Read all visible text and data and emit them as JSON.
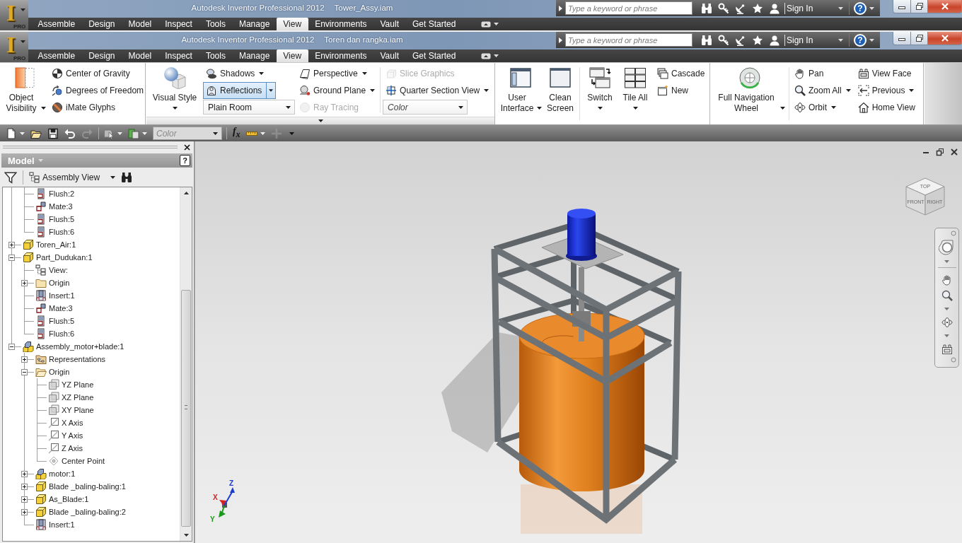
{
  "windows": [
    {
      "logo": "I",
      "edition": "PRO",
      "title": "Autodesk Inventor Professional 2012",
      "document": "Tower_Assy.iam",
      "search": {
        "placeholder": "Type a keyword or phrase"
      },
      "sign_in": "Sign In",
      "help": "?",
      "tabs": [
        {
          "label": "Assemble",
          "selected": false
        },
        {
          "label": "Design",
          "selected": false
        },
        {
          "label": "Model",
          "selected": false
        },
        {
          "label": "Inspect",
          "selected": false
        },
        {
          "label": "Tools",
          "selected": false
        },
        {
          "label": "Manage",
          "selected": false
        },
        {
          "label": "View",
          "selected": true
        },
        {
          "label": "Environments",
          "selected": false
        },
        {
          "label": "Vault",
          "selected": false
        },
        {
          "label": "Get Started",
          "selected": false
        }
      ]
    },
    {
      "logo": "I",
      "edition": "PRO",
      "title": "Autodesk Inventor Professional 2012",
      "document": "Toren dan rangka.iam",
      "search": {
        "placeholder": "Type a keyword or phrase"
      },
      "sign_in": "Sign In",
      "help": "?",
      "tabs": [
        {
          "label": "Assemble",
          "selected": false
        },
        {
          "label": "Design",
          "selected": false
        },
        {
          "label": "Model",
          "selected": false
        },
        {
          "label": "Inspect",
          "selected": false
        },
        {
          "label": "Tools",
          "selected": false
        },
        {
          "label": "Manage",
          "selected": false
        },
        {
          "label": "View",
          "selected": true
        },
        {
          "label": "Environments",
          "selected": false
        },
        {
          "label": "Vault",
          "selected": false
        },
        {
          "label": "Get Started",
          "selected": false
        }
      ]
    }
  ],
  "ribbon": {
    "panels": [
      {
        "slideout": false,
        "groups": [
          {
            "columns": [
              {
                "kind": "large",
                "items": [
                  {
                    "label": "Object Visibility",
                    "dropdown": true
                  }
                ]
              },
              {
                "kind": "small",
                "items": [
                  {
                    "kind": "button",
                    "label": "Center of Gravity",
                    "dropdown": false,
                    "on": false,
                    "disabled": false
                  },
                  {
                    "kind": "button",
                    "label": "Degrees of Freedom",
                    "dropdown": false,
                    "on": false,
                    "disabled": false
                  },
                  {
                    "kind": "button",
                    "label": "iMate Glyphs",
                    "dropdown": false,
                    "on": false,
                    "disabled": false
                  }
                ]
              }
            ]
          }
        ]
      },
      {
        "slideout": true,
        "groups": [
          {
            "columns": [
              {
                "kind": "large",
                "items": [
                  {
                    "label": "Visual Style",
                    "dropdown": true
                  }
                ]
              },
              {
                "kind": "small",
                "items": [
                  {
                    "kind": "button",
                    "label": "Shadows",
                    "dropdown": true,
                    "on": false,
                    "disabled": false
                  },
                  {
                    "kind": "button",
                    "label": "Reflections",
                    "dropdown": true,
                    "on": true,
                    "disabled": false
                  },
                  {
                    "kind": "select",
                    "value": "Plain Room"
                  }
                ]
              },
              {
                "kind": "small",
                "items": [
                  {
                    "kind": "button",
                    "label": "Perspective",
                    "dropdown": true,
                    "on": false,
                    "disabled": false
                  },
                  {
                    "kind": "button",
                    "label": "Ground Plane",
                    "dropdown": true,
                    "on": false,
                    "disabled": false
                  },
                  {
                    "kind": "button",
                    "label": "Ray Tracing",
                    "dropdown": false,
                    "on": false,
                    "disabled": true
                  }
                ]
              }
            ]
          },
          {
            "columns": [
              {
                "kind": "small",
                "items": [
                  {
                    "kind": "button",
                    "label": "Slice Graphics",
                    "dropdown": false,
                    "on": false,
                    "disabled": true
                  },
                  {
                    "kind": "button",
                    "label": "Quarter Section View",
                    "dropdown": true,
                    "on": false,
                    "disabled": false
                  },
                  {
                    "kind": "select",
                    "placeholder": "Color"
                  }
                ]
              }
            ]
          }
        ]
      },
      {
        "slideout": false,
        "groups": [
          {
            "columns": [
              {
                "kind": "large",
                "items": [
                  {
                    "label": "User Interface",
                    "dropdown": true
                  },
                  {
                    "label": "Clean Screen",
                    "dropdown": false
                  }
                ]
              }
            ]
          },
          {
            "columns": [
              {
                "kind": "large",
                "items": [
                  {
                    "label": "Switch",
                    "dropdown": true
                  },
                  {
                    "label": "Tile All",
                    "dropdown": true
                  }
                ]
              },
              {
                "kind": "small",
                "items": [
                  {
                    "kind": "button",
                    "label": "Cascade",
                    "dropdown": false,
                    "on": false,
                    "disabled": false
                  },
                  {
                    "kind": "button",
                    "label": "New",
                    "dropdown": false,
                    "on": false,
                    "disabled": false
                  }
                ]
              }
            ]
          }
        ]
      },
      {
        "slideout": false,
        "groups": [
          {
            "columns": [
              {
                "kind": "large",
                "items": [
                  {
                    "label": "Full Navigation Wheel",
                    "dropdown": true
                  }
                ]
              }
            ]
          },
          {
            "columns": [
              {
                "kind": "small",
                "items": [
                  {
                    "kind": "button",
                    "label": "Pan",
                    "dropdown": false,
                    "on": false,
                    "disabled": false
                  },
                  {
                    "kind": "button",
                    "label": "Zoom All",
                    "dropdown": true,
                    "on": false,
                    "disabled": false
                  },
                  {
                    "kind": "button",
                    "label": "Orbit",
                    "dropdown": true,
                    "on": false,
                    "disabled": false
                  }
                ]
              },
              {
                "kind": "small",
                "items": [
                  {
                    "kind": "button",
                    "label": "View Face",
                    "dropdown": false,
                    "on": false,
                    "disabled": false
                  },
                  {
                    "kind": "button",
                    "label": "Previous",
                    "dropdown": true,
                    "on": false,
                    "disabled": false
                  },
                  {
                    "kind": "button",
                    "label": "Home View",
                    "dropdown": false,
                    "on": false,
                    "disabled": false
                  }
                ]
              }
            ]
          }
        ]
      }
    ]
  },
  "quick_access": {
    "tools": [
      {
        "dropdown": true,
        "disabled": false
      },
      {
        "dropdown": false,
        "disabled": false
      },
      {
        "dropdown": false,
        "disabled": false
      },
      {
        "dropdown": false,
        "disabled": false
      },
      {
        "dropdown": false,
        "disabled": true
      },
      {
        "dropdown": true,
        "disabled": false
      },
      {
        "dropdown": true,
        "disabled": false
      }
    ],
    "appearance": {
      "placeholder": "Color"
    },
    "parameters": {
      "label": "f$_{x}$"
    },
    "tools_after": [
      {
        "dropdown": true,
        "disabled": false
      },
      {
        "dropdown": false,
        "disabled": true
      }
    ]
  },
  "browser": {
    "title": "Model",
    "help": "?",
    "view_mode": "Assembly View",
    "tree": [
      {
        "children": [
          {
            "kind": "flush",
            "label": "Flush:2"
          },
          {
            "kind": "mate",
            "label": "Mate:3"
          },
          {
            "kind": "flush",
            "label": "Flush:5"
          },
          {
            "kind": "flush",
            "label": "Flush:6"
          }
        ]
      },
      {
        "kind": "part",
        "label": "Toren_Air:1",
        "expanded": false
      },
      {
        "kind": "part",
        "label": "Part_Dudukan:1",
        "expanded": true,
        "children": [
          {
            "kind": "view",
            "label": "View:"
          },
          {
            "kind": "folder",
            "label": "Origin",
            "expanded": false
          },
          {
            "kind": "insert",
            "label": "Insert:1"
          },
          {
            "kind": "mate",
            "label": "Mate:3"
          },
          {
            "kind": "flush",
            "label": "Flush:5"
          },
          {
            "kind": "flush",
            "label": "Flush:6"
          }
        ]
      },
      {
        "kind": "assembly",
        "label": "Assembly_motor+blade:1",
        "expanded": true,
        "children": [
          {
            "kind": "representations",
            "label": "Representations",
            "expanded": false
          },
          {
            "kind": "folder",
            "label": "Origin",
            "expanded": true,
            "children": [
              {
                "kind": "plane",
                "label": "YZ Plane"
              },
              {
                "kind": "plane",
                "label": "XZ Plane"
              },
              {
                "kind": "plane",
                "label": "XY Plane"
              },
              {
                "kind": "axis",
                "label": "X Axis"
              },
              {
                "kind": "axis",
                "label": "Y Axis"
              },
              {
                "kind": "axis",
                "label": "Z Axis"
              },
              {
                "kind": "point",
                "label": "Center Point"
              }
            ]
          },
          {
            "kind": "assembly",
            "label": "motor:1",
            "expanded": false
          },
          {
            "kind": "part",
            "label": "Blade _baling-baling:1",
            "expanded": false
          },
          {
            "kind": "part",
            "label": "As_Blade:1",
            "expanded": false
          },
          {
            "kind": "part",
            "label": "Blade _baling-baling:2",
            "expanded": false
          },
          {
            "kind": "insert",
            "label": "Insert:1"
          }
        ]
      }
    ]
  },
  "viewport": {
    "view_cube": {
      "faces": [
        "TOP",
        "FRONT",
        "RIGHT"
      ]
    },
    "triad": [
      {
        "label": "X",
        "color": "#d42020"
      },
      {
        "label": "Y",
        "color": "#1a9a1a"
      },
      {
        "label": "Z",
        "color": "#1a3ad0"
      }
    ]
  }
}
